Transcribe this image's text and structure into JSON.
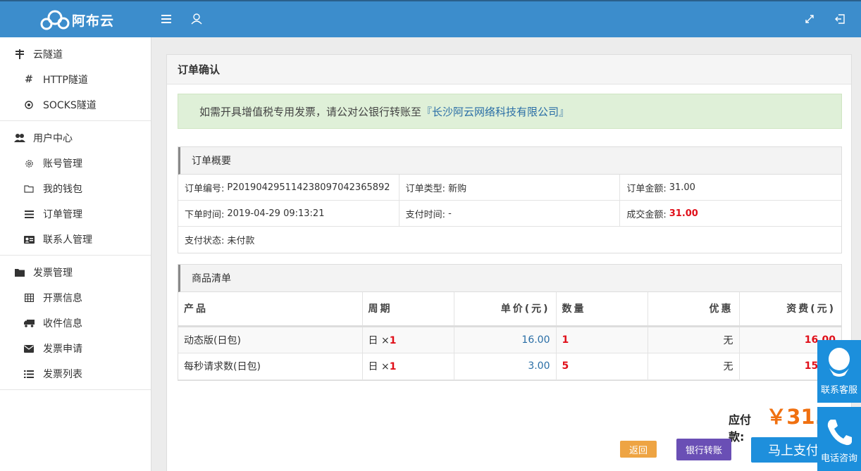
{
  "header": {
    "brand": "阿布云"
  },
  "sidebar": {
    "groups": [
      {
        "title": "云隧道",
        "items": [
          {
            "label": "HTTP隧道"
          },
          {
            "label": "SOCKS隧道"
          }
        ]
      },
      {
        "title": "用户中心",
        "items": [
          {
            "label": "账号管理"
          },
          {
            "label": "我的钱包"
          },
          {
            "label": "订单管理"
          },
          {
            "label": "联系人管理"
          }
        ]
      },
      {
        "title": "发票管理",
        "items": [
          {
            "label": "开票信息"
          },
          {
            "label": "收件信息"
          },
          {
            "label": "发票申请"
          },
          {
            "label": "发票列表"
          }
        ]
      }
    ]
  },
  "panel": {
    "title": "订单确认"
  },
  "notice": {
    "text": "如需开具增值税专用发票，请公对公银行转账至",
    "company": "『长沙阿云网络科技有限公司』"
  },
  "summary": {
    "title": "订单概要",
    "order_no_label": "订单编号:",
    "order_no": "P2019042951142380970423658​92",
    "order_type_label": "订单类型:",
    "order_type": "新购",
    "order_amount_label": "订单金额:",
    "order_amount": "31.00",
    "order_time_label": "下单时间:",
    "order_time": "2019-04-29 09:13:21",
    "pay_time_label": "支付时间:",
    "pay_time": "-",
    "deal_amount_label": "成交金额:",
    "deal_amount": "31.00",
    "pay_status_label": "支付状态:",
    "pay_status": "未付款"
  },
  "products": {
    "title": "商品清单",
    "columns": [
      "产品",
      "周期",
      "单价(元)",
      "数量",
      "优惠",
      "资费(元)"
    ],
    "rows": [
      {
        "name": "动态版(日包)",
        "period_unit": "日 ×",
        "period_qty": "1",
        "price": "16.00",
        "qty": "1",
        "discount": "无",
        "fee": "16.00"
      },
      {
        "name": "每秒请求数(日包)",
        "period_unit": "日 ×",
        "period_qty": "1",
        "price": "3.00",
        "qty": "5",
        "discount": "无",
        "fee": "15.00"
      }
    ]
  },
  "payable": {
    "label": "应付款:",
    "amount": "￥31.00"
  },
  "buttons": {
    "back": "返回",
    "bank": "银行转账",
    "pay": "马上支付"
  },
  "float": {
    "service": "联系客服",
    "phone": "电话咨询"
  }
}
